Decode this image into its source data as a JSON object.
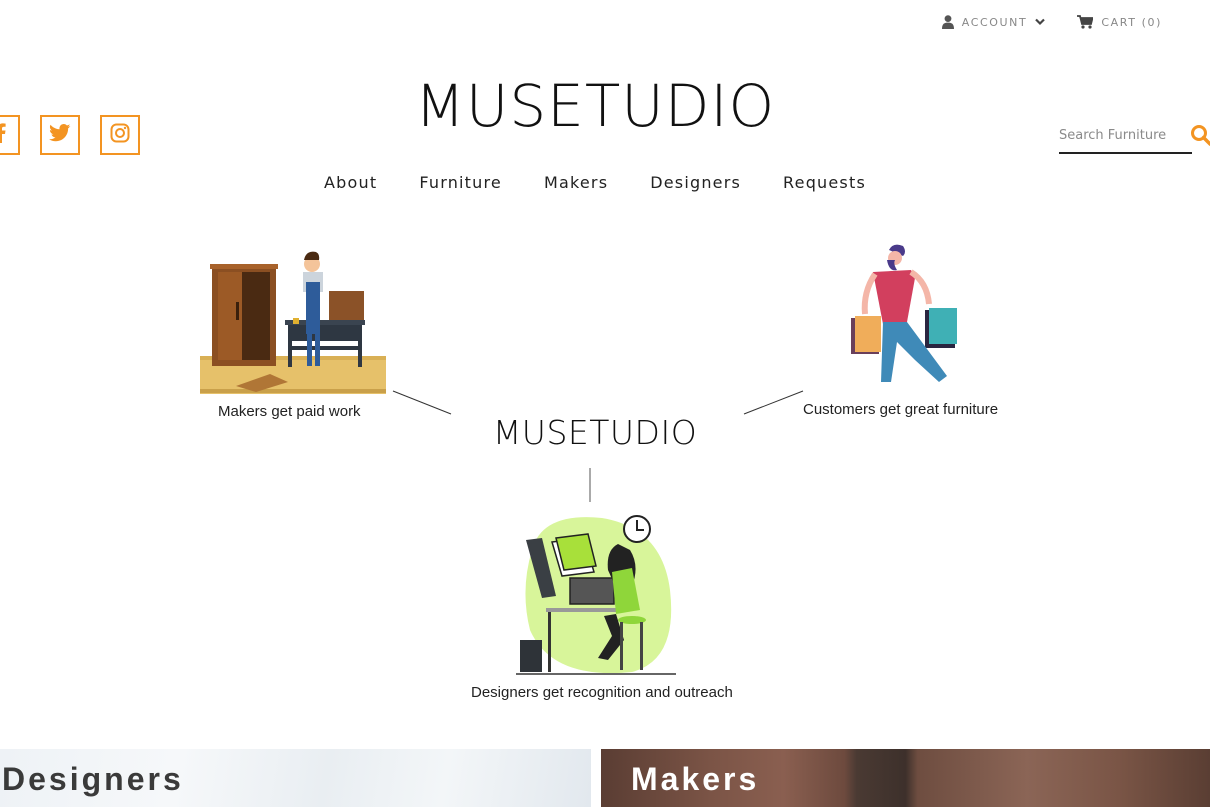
{
  "header": {
    "account_label": "ACCOUNT",
    "cart_label": "CART (0)",
    "logo": "MUSETUDIO",
    "search_placeholder": "Search Furniture"
  },
  "social": [
    {
      "name": "facebook",
      "icon": "facebook-icon"
    },
    {
      "name": "twitter",
      "icon": "twitter-icon"
    },
    {
      "name": "instagram",
      "icon": "instagram-icon"
    }
  ],
  "nav": {
    "items": [
      "About",
      "Furniture",
      "Makers",
      "Designers",
      "Requests"
    ]
  },
  "diagram": {
    "center_logo": "MUSETUDIO",
    "makers_caption": "Makers get paid work",
    "customers_caption": "Customers get great furniture",
    "designers_caption": "Designers get recognition and outreach"
  },
  "banners": {
    "designers": "Designers",
    "makers": "Makers"
  },
  "colors": {
    "accent": "#f39422",
    "text": "#222222"
  }
}
